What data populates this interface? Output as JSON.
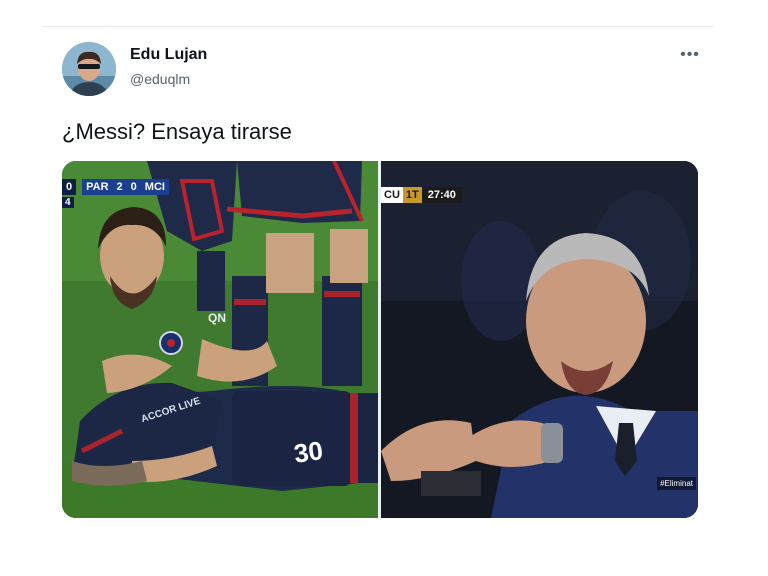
{
  "tweet": {
    "display_name": "Edu Lujan",
    "handle": "@eduqlm",
    "text": "¿Messi? Ensaya tirarse",
    "more_icon": "more-icon"
  },
  "media": {
    "left_overlay": {
      "score_left_edge": "0",
      "minute_small": "4",
      "team_home": "PAR",
      "score_home": "2",
      "score_away": "0",
      "team_away": "MCI",
      "shirt_number": "30",
      "sponsor": "QN",
      "front_sponsor": "ACCOR LIVE"
    },
    "right_overlay": {
      "channel": "CU",
      "period": "1T",
      "clock": "27:40",
      "hashtag": "#Eliminat"
    }
  },
  "colors": {
    "bug_blue": "#1a3f8e",
    "bug_dark": "#0e1f45",
    "clock_gold": "#c59a2a"
  }
}
